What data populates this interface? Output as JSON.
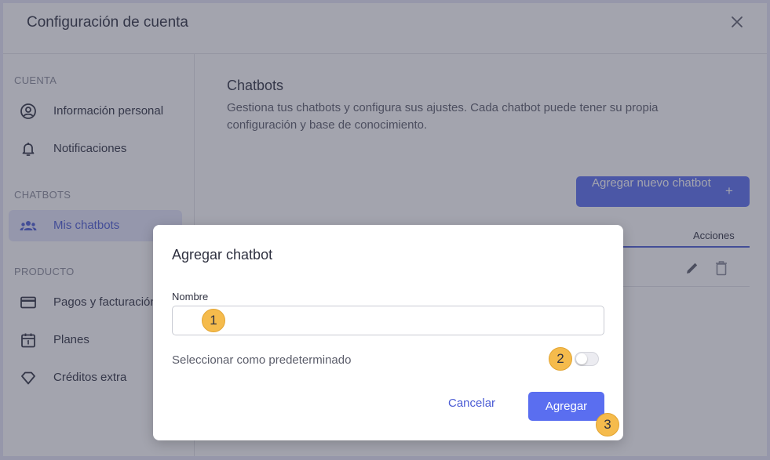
{
  "header": {
    "title": "Configuración de cuenta"
  },
  "sidebar": {
    "sections": [
      {
        "label": "CUENTA"
      },
      {
        "label": "CHATBOTS"
      },
      {
        "label": "PRODUCTO"
      }
    ],
    "items": [
      {
        "label": "Información personal",
        "icon": "user-circle-icon"
      },
      {
        "label": "Notificaciones",
        "icon": "bell-icon"
      },
      {
        "label": "Mis chatbots",
        "icon": "group-icon"
      },
      {
        "label": "Pagos y facturación",
        "icon": "credit-card-icon"
      },
      {
        "label": "Planes",
        "icon": "calendar-icon"
      },
      {
        "label": "Créditos extra",
        "icon": "diamond-icon"
      }
    ]
  },
  "main": {
    "title": "Chatbots",
    "description": "Gestiona tus chatbots y configura sus ajustes. Cada chatbot puede tener su propia configuración y base de conocimiento.",
    "add_button": "Agregar nuevo chatbot",
    "add_button_icon": "+",
    "table": {
      "actions_header": "Acciones"
    }
  },
  "modal": {
    "title": "Agregar chatbot",
    "name_label": "Nombre",
    "name_value": "",
    "default_label": "Seleccionar como predeterminado",
    "default_on": false,
    "cancel_label": "Cancelar",
    "add_label": "Agregar"
  },
  "markers": [
    "1",
    "2",
    "3"
  ],
  "colors": {
    "accent": "#5a6ef0",
    "marker": "#f5bb4c"
  }
}
